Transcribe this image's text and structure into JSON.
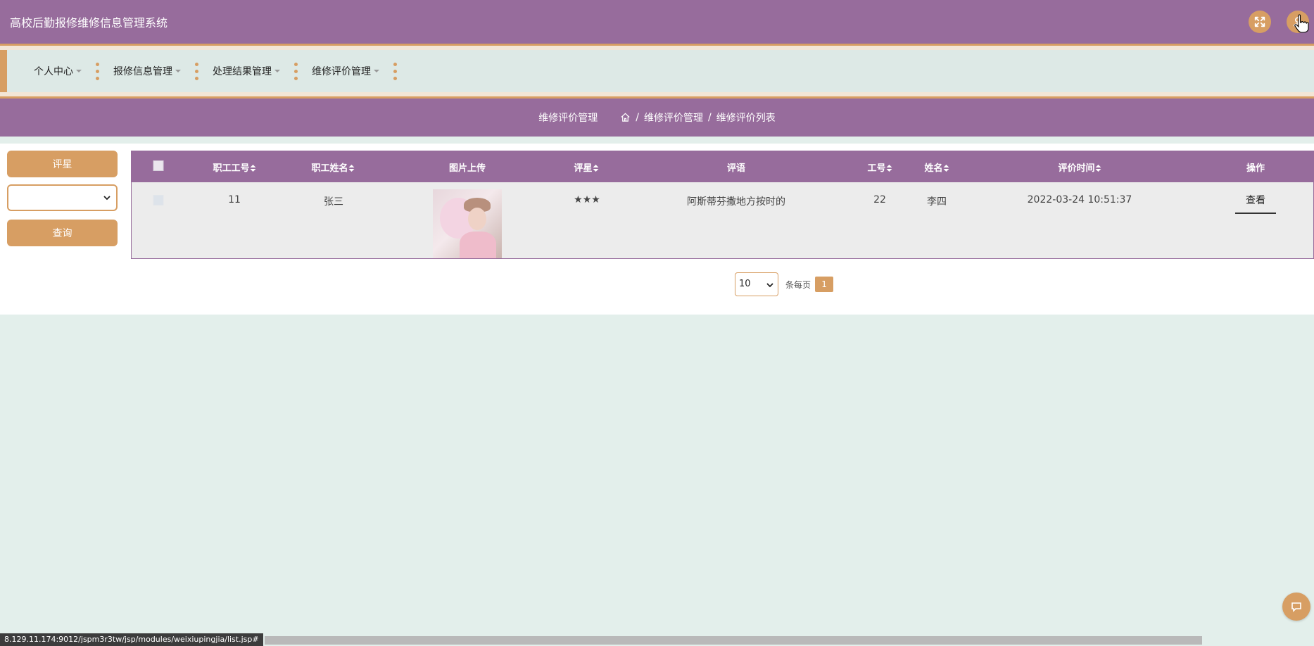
{
  "app": {
    "title": "高校后勤报修维修信息管理系统"
  },
  "header": {
    "fullscreen_icon": "fullscreen-icon",
    "user_icon": "user-icon"
  },
  "nav": {
    "items": [
      {
        "label": "个人中心"
      },
      {
        "label": "报修信息管理"
      },
      {
        "label": "处理结果管理"
      },
      {
        "label": "维修评价管理"
      }
    ]
  },
  "breadcrumb": {
    "section": "维修评价管理",
    "path": [
      "维修评价管理",
      "维修评价列表"
    ],
    "separator": "/"
  },
  "search": {
    "label": "评星",
    "select_value": "",
    "query_label": "查询"
  },
  "table": {
    "headers": {
      "staff_no": "职工工号",
      "staff_name": "职工姓名",
      "photo": "图片上传",
      "rating": "评星",
      "comment": "评语",
      "worker_no": "工号",
      "name": "姓名",
      "time": "评价时间",
      "action": "操作"
    },
    "rows": [
      {
        "staff_no": "11",
        "staff_name": "张三",
        "rating": "★★★",
        "comment": "阿斯蒂芬撒地方按时的",
        "worker_no": "22",
        "name": "李四",
        "time": "2022-03-24 10:51:37",
        "action": "查看"
      }
    ]
  },
  "pagination": {
    "page_size": "10",
    "per_page_label": "条每页",
    "current_page": "1"
  },
  "status_bar": {
    "url": "8.129.11.174:9012/jspm3r3tw/jsp/modules/weixiupingjia/list.jsp#"
  },
  "colors": {
    "primary": "#976c9c",
    "accent": "#d79e63",
    "nav_bg": "#dde9e6",
    "page_bg": "#e3efeb"
  }
}
